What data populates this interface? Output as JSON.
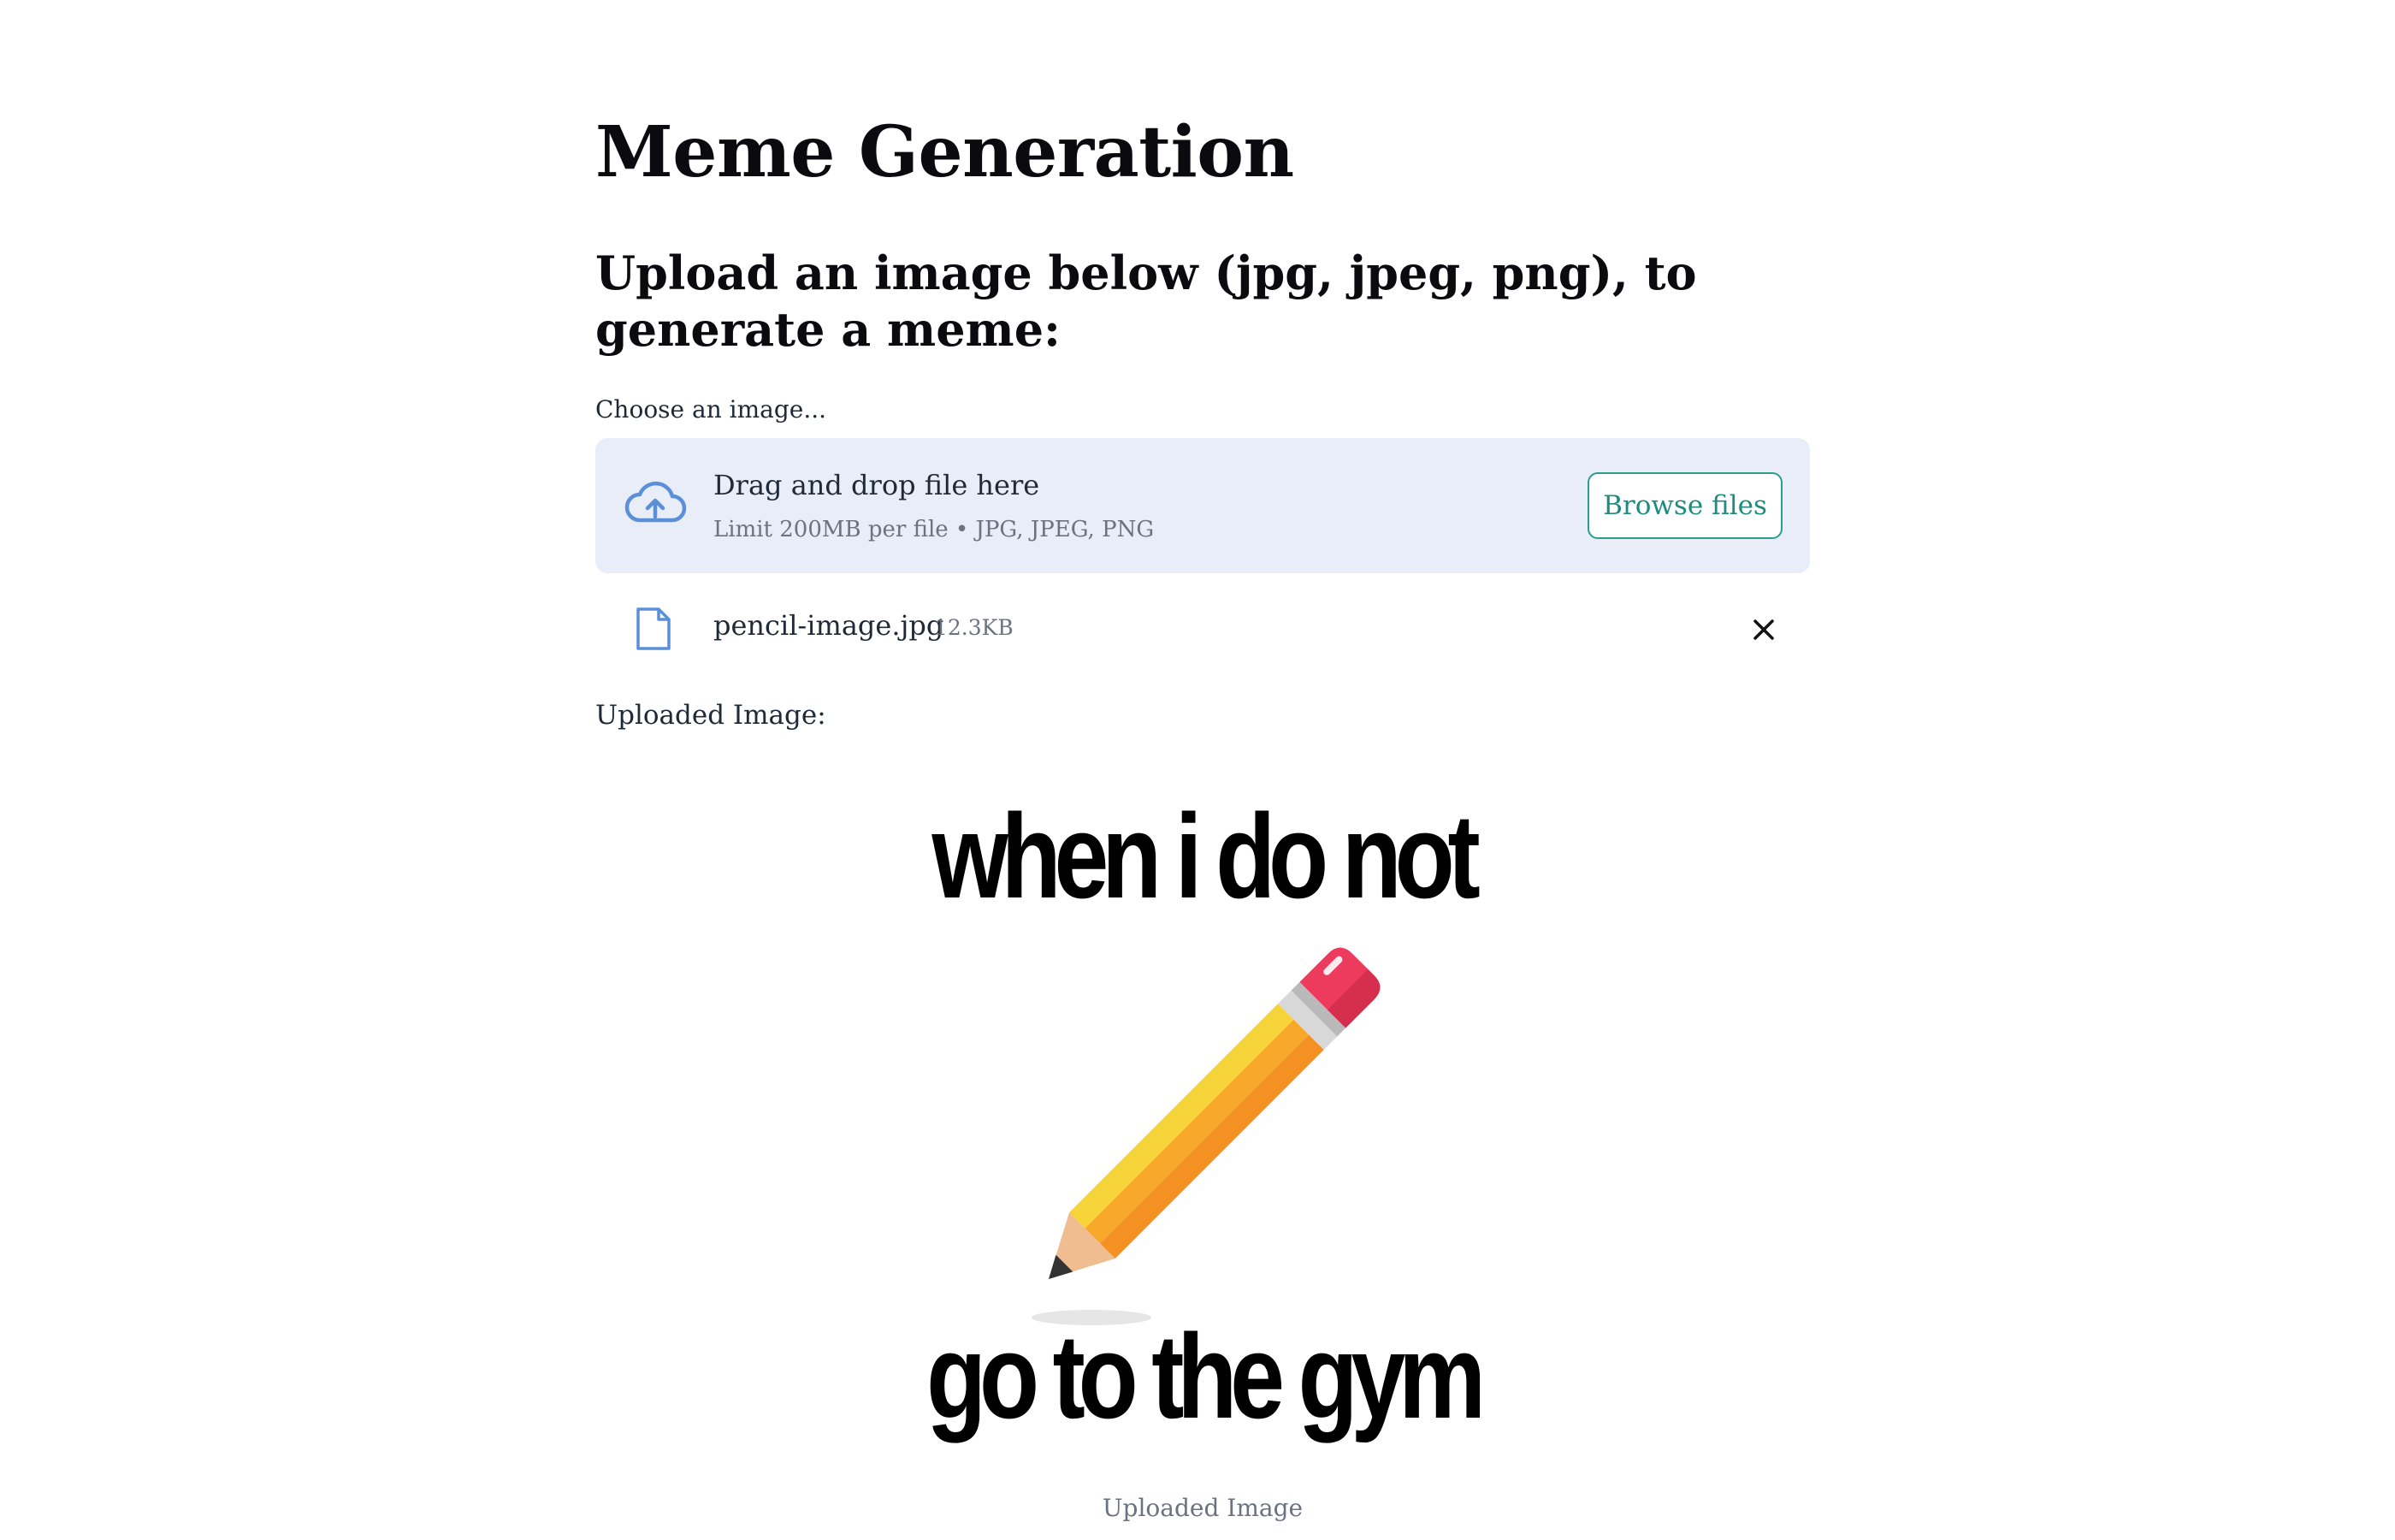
{
  "page": {
    "title": "Meme Generation",
    "subtitle": "Upload an image below (jpg, jpeg, png), to generate a meme:"
  },
  "uploader": {
    "label": "Choose an image...",
    "drop_text": "Drag and drop file here",
    "limit_text": "Limit 200MB per file • JPG, JPEG, PNG",
    "browse_label": "Browse files",
    "icon": "cloud-upload-icon"
  },
  "file": {
    "name": "pencil-image.jpg",
    "size": "12.3KB",
    "icon": "file-icon",
    "remove_icon": "close-icon"
  },
  "result": {
    "label": "Uploaded Image:",
    "meme_top_text": "when i do not",
    "meme_bottom_text": "go to the gym",
    "caption": "Uploaded Image"
  },
  "colors": {
    "dropzone_bg": "#e8edf7",
    "accent": "#2a9d8f",
    "icon_blue": "#5b8fd8"
  }
}
